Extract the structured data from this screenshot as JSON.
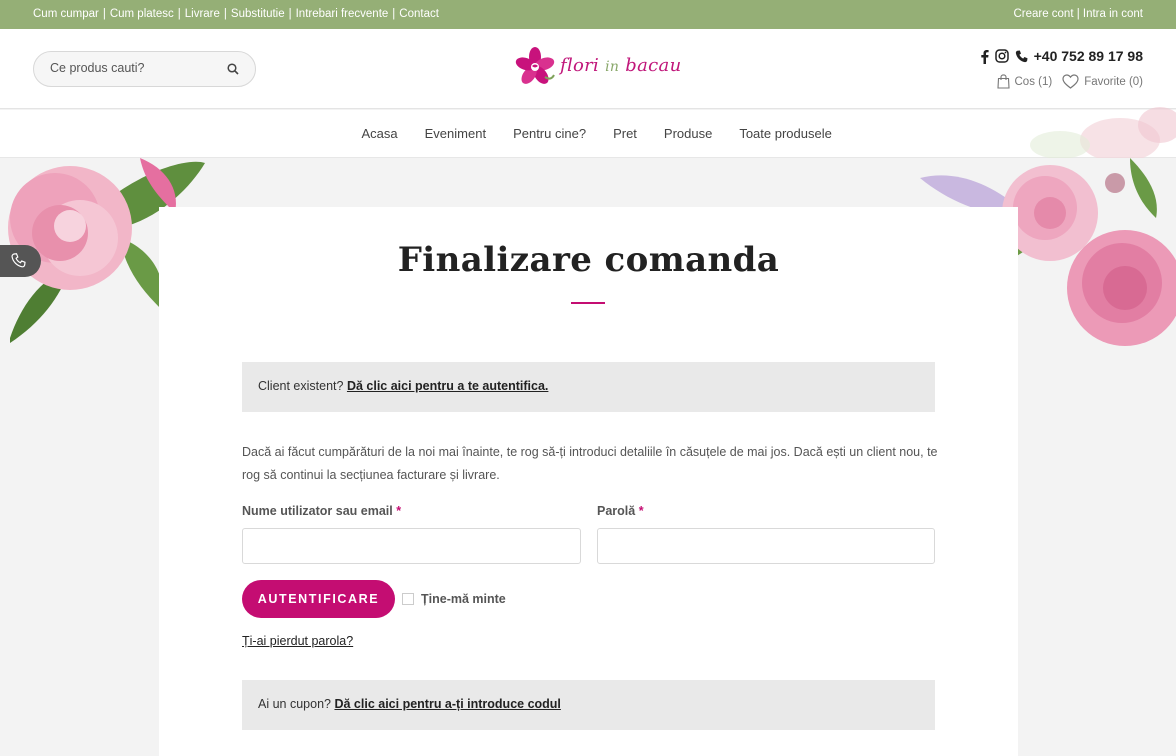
{
  "topbar": {
    "links": [
      "Cum cumpar",
      "Cum platesc",
      "Livrare",
      "Substitutie",
      "Intrebari frecvente",
      "Contact"
    ],
    "separator": "|",
    "account": "Creare cont | Intra in cont"
  },
  "header": {
    "search_placeholder": "Ce produs cauti?",
    "logo": {
      "word1": "flori",
      "word2": "in",
      "word3": "bacau"
    },
    "phone": "+40 752 89 17 98",
    "cart": "Cos (1)",
    "favorites": "Favorite (0)"
  },
  "nav": {
    "items": [
      "Acasa",
      "Eveniment",
      "Pentru cine?",
      "Pret",
      "Produse",
      "Toate produsele"
    ]
  },
  "page": {
    "title": "Finalizare comanda",
    "login_notice": {
      "text": "Client existent?",
      "link": "Dă clic aici pentru a te autentifica."
    },
    "intro": "Dacă ai făcut cumpărături de la noi mai înainte, te rog să-ți introduci detaliile în căsuțele de mai jos. Dacă ești un client nou, te rog să continui la secțiunea facturare și livrare.",
    "username_label": "Nume utilizator sau email",
    "password_label": "Parolă",
    "required_mark": "*",
    "login_button": "AUTENTIFICARE",
    "remember_label": "Ține-mă minte",
    "lost_password": "Ți-ai pierdut parola?",
    "coupon_notice": {
      "text": "Ai un cupon?",
      "link": "Dă clic aici pentru a-ți introduce codul"
    }
  },
  "colors": {
    "topbar": "#95af76",
    "accent": "#c40d72",
    "notice_bg": "#e9e9e9"
  }
}
